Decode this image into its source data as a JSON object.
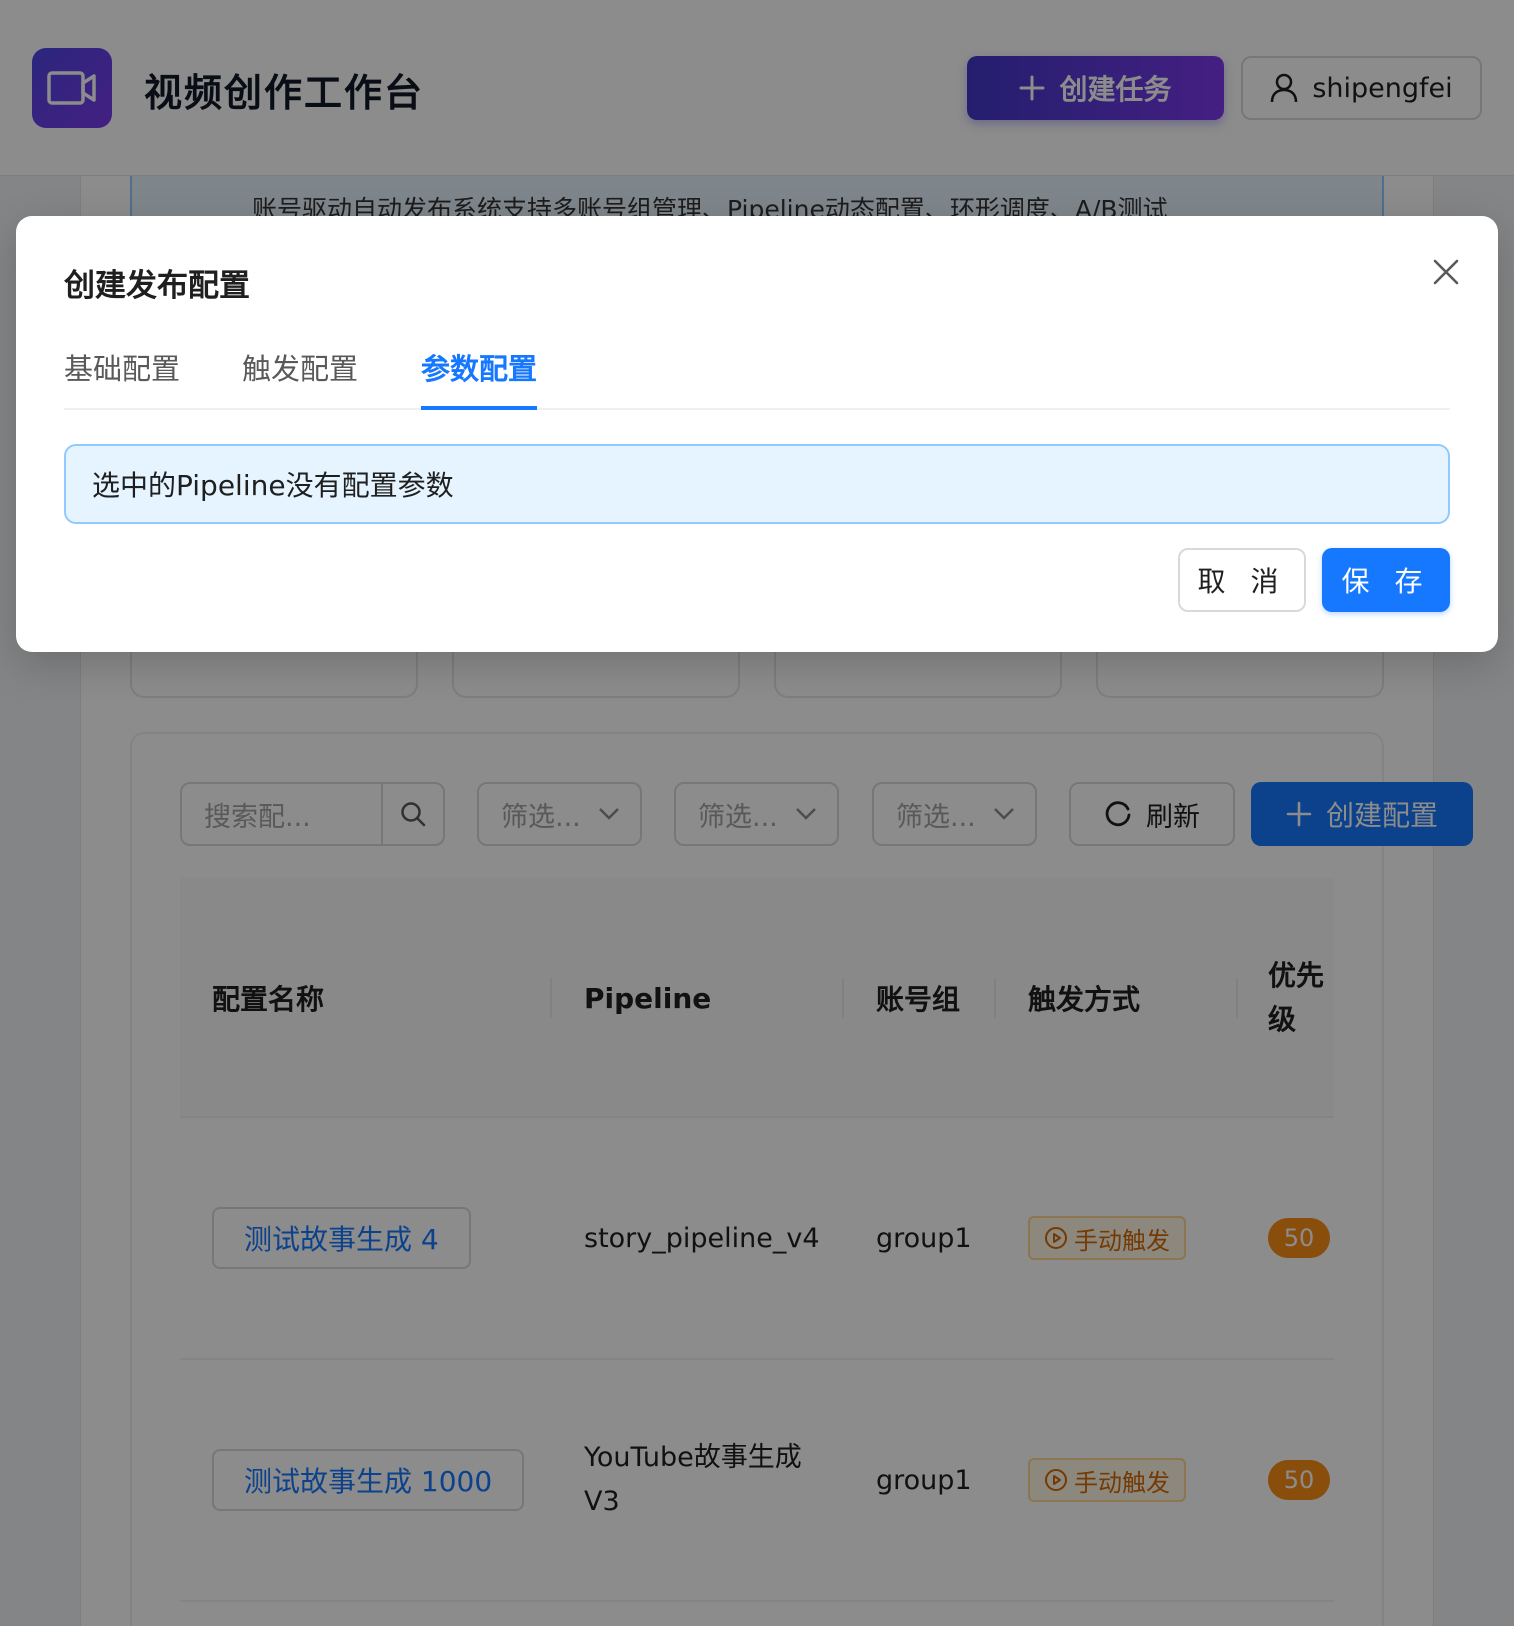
{
  "header": {
    "app_title": "视频创作工作台",
    "create_task_label": "创建任务",
    "user_name": "shipengfei"
  },
  "banner": {
    "text": "账号驱动自动发布系统支持多账号组管理、Pipeline动态配置、环形调度、A/B测试"
  },
  "toolbar": {
    "search_placeholder": "搜索配...",
    "filters": [
      "筛选...",
      "筛选...",
      "筛选..."
    ],
    "refresh_label": "刷新",
    "create_config_label": "创建配置"
  },
  "table": {
    "columns": [
      "配置名称",
      "Pipeline",
      "账号组",
      "触发方式",
      "优先级"
    ],
    "rows": [
      {
        "name": "测试故事生成 4",
        "pipeline": "story_pipeline_v4",
        "group": "group1",
        "trigger": "手动触发",
        "priority": "50"
      },
      {
        "name": "测试故事生成 1000",
        "pipeline": "YouTube故事生成V3",
        "group": "group1",
        "trigger": "手动触发",
        "priority": "50"
      }
    ]
  },
  "modal": {
    "title": "创建发布配置",
    "tabs": [
      "基础配置",
      "触发配置",
      "参数配置"
    ],
    "active_tab": "参数配置",
    "alert_text": "选中的Pipeline没有配置参数",
    "cancel_label": "取 消",
    "save_label": "保 存"
  },
  "colors": {
    "primary": "#1677ff",
    "brand_gradient_start": "#4338ca",
    "brand_gradient_end": "#7c3aed",
    "warning": "#fa8c16"
  }
}
